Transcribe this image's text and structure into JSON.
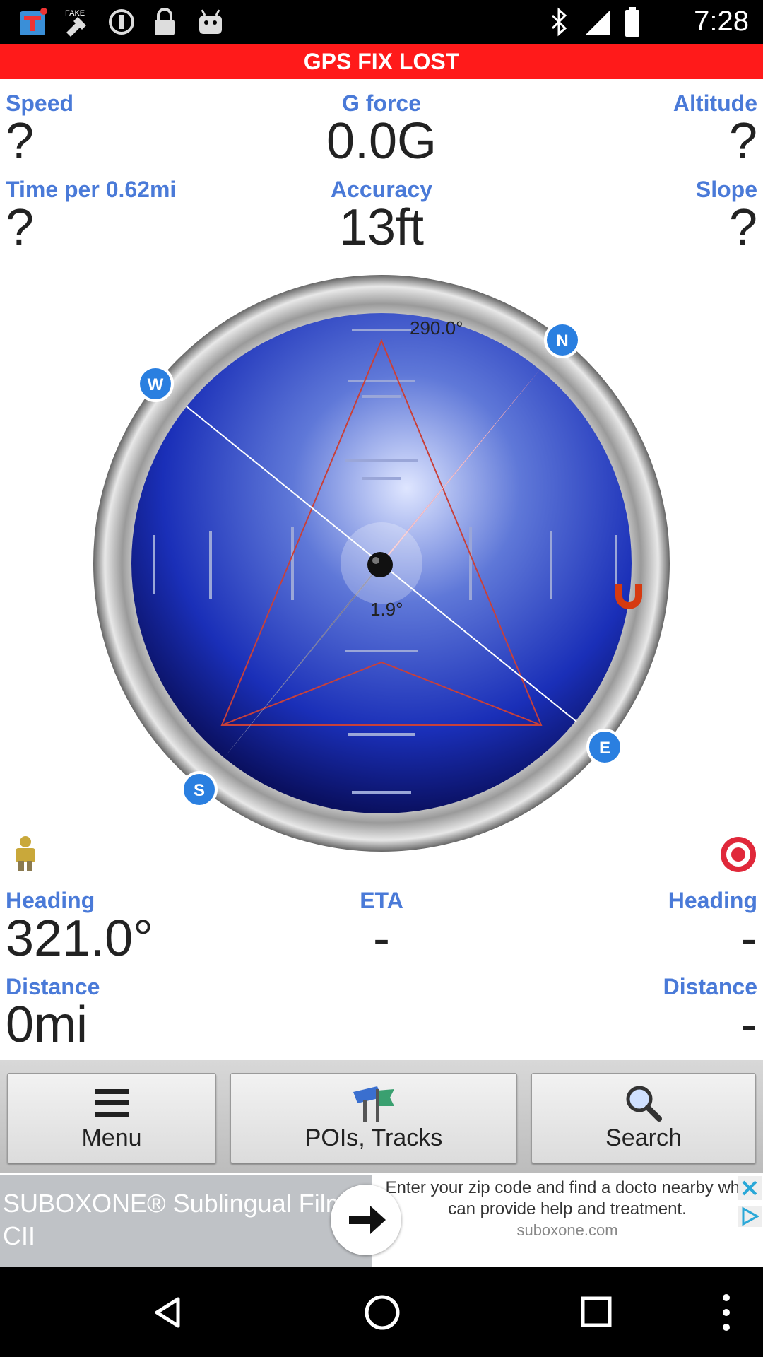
{
  "status_bar": {
    "time": "7:28",
    "icons": [
      "app-notification-icon",
      "fake-gps-icon",
      "info-icon",
      "lock-icon",
      "android-icon",
      "bluetooth-icon",
      "signal-icon",
      "battery-icon"
    ]
  },
  "banner": {
    "text": "GPS FIX LOST",
    "color": "#ff1a1a"
  },
  "stats": {
    "speed": {
      "label": "Speed",
      "value": "?"
    },
    "gforce": {
      "label": "G force",
      "value": "0.0G"
    },
    "altitude": {
      "label": "Altitude",
      "value": "?"
    },
    "time_per": {
      "label": "Time per 0.62mi",
      "value": "?"
    },
    "accuracy": {
      "label": "Accuracy",
      "value": "13ft"
    },
    "slope": {
      "label": "Slope",
      "value": "?"
    }
  },
  "compass": {
    "top_reading": "290.0°",
    "center_reading": "1.9°",
    "directions": {
      "north": "N",
      "south": "S",
      "east": "E",
      "west": "W"
    }
  },
  "nav": {
    "heading_left": {
      "label": "Heading",
      "value": "321.0°"
    },
    "eta": {
      "label": "ETA",
      "value": "-"
    },
    "heading_right": {
      "label": "Heading",
      "value": "-"
    },
    "distance_left": {
      "label": "Distance",
      "value": "0mi"
    },
    "distance_right": {
      "label": "Distance",
      "value": "-"
    }
  },
  "toolbar": {
    "menu_label": "Menu",
    "pois_label": "POIs, Tracks",
    "search_label": "Search"
  },
  "ad": {
    "title": "SUBOXONE® Sublingual Film CII",
    "body": "Enter your zip code and find a docto nearby who can provide help and treatment.",
    "domain": "suboxone.com"
  },
  "colors": {
    "label_blue": "#4a7ad8",
    "compass_blue": "#1a2fb8",
    "needle_red": "#e0506a"
  }
}
